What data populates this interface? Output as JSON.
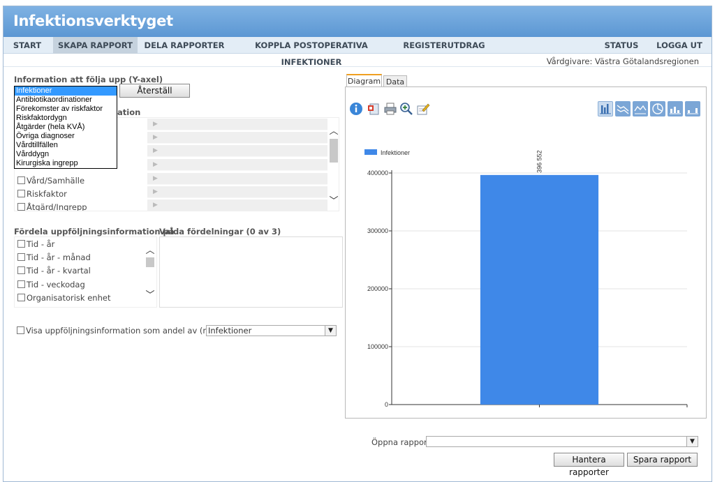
{
  "app": {
    "title": "Infektionsverktyget"
  },
  "nav": {
    "start": "START",
    "skapa": "SKAPA RAPPORT",
    "dela": "DELA RAPPORTER",
    "koppla": "KOPPLA POSTOPERATIVA INFEKTIONER",
    "register": "REGISTERUTDRAG",
    "status": "STATUS",
    "logout": "LOGGA UT"
  },
  "vardgivare": "Vårdgivare: Västra Götalandsregionen",
  "yaxis": {
    "label": "Information att följa upp (Y-axel)",
    "reset_label": "Återställ",
    "options": [
      "Infektioner",
      "Antibiotikaordinationer",
      "Förekomster av riskfaktor",
      "Riskfaktordygn",
      "Åtgärder (hela KVÅ)",
      "Övriga diagnoser",
      "Vårdtillfällen",
      "Vårddygn",
      "Kirurgiska ingrepp"
    ],
    "selected": "Infektioner"
  },
  "filter": {
    "label_partial": "ation",
    "items": [
      "Vård/Samhälle",
      "Riskfaktor",
      "Åtgärd/Ingrepp"
    ]
  },
  "distribute": {
    "label": "Fördela uppföljningsinformation på",
    "items": [
      "Tid - år",
      "Tid - år - månad",
      "Tid - år - kvartal",
      "Tid - veckodag",
      "Organisatorisk enhet"
    ]
  },
  "selected_distributions": {
    "label": "Valda fördelningar (0 av 3)"
  },
  "andel": {
    "label": "Visa uppföljningsinformation som andel av (nämnare)",
    "value": "Infektioner"
  },
  "chart_tabs": {
    "diagram": "Diagram",
    "data": "Data"
  },
  "toolbar_icons": [
    "info-icon",
    "export-icon",
    "print-icon",
    "zoom-icon",
    "edit-icon"
  ],
  "chart_type_icons": [
    "bar-chart-icon",
    "line-chart-icon",
    "area-chart-icon",
    "pie-chart-icon",
    "column-chart-icon",
    "stacked-chart-icon"
  ],
  "colors": {
    "bar": "#3f88e8",
    "header": "#6aa3da",
    "selected_option": "#3399ff"
  },
  "chart_data": {
    "type": "bar",
    "categories": [
      ""
    ],
    "series": [
      {
        "name": "Infektioner",
        "values": [
          396552
        ]
      }
    ],
    "data_labels": [
      "396 552"
    ],
    "ylim": [
      0,
      400000
    ],
    "yticks": [
      0,
      100000,
      200000,
      300000,
      400000
    ],
    "ytick_labels": [
      "0",
      "100000",
      "200000",
      "300000",
      "400000"
    ],
    "grid": true,
    "legend": "top-left"
  },
  "report": {
    "open_label": "Öppna rapport",
    "open_value": "",
    "manage_label": "Hantera rapporter",
    "save_label": "Spara rapport"
  }
}
